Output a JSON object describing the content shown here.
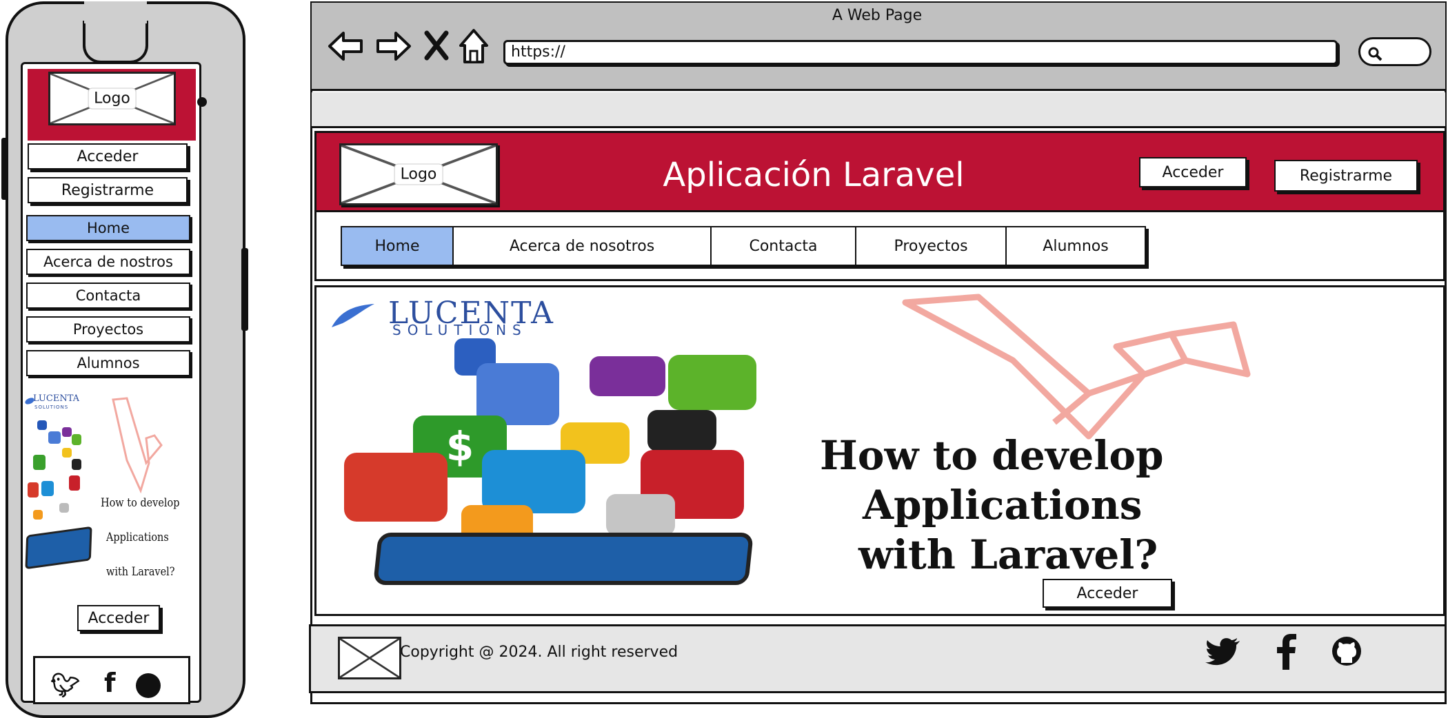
{
  "colors": {
    "brand": "#BC1234",
    "active": "#99BBF0",
    "chrome": "#C0C0C0",
    "strip": "#E6E6E6",
    "laravel": "#F2A8A0"
  },
  "browser": {
    "title": "A Web Page",
    "url": "https://",
    "icons": [
      "back-icon",
      "forward-icon",
      "close-icon",
      "home-icon",
      "search-icon"
    ]
  },
  "header": {
    "logo_label": "Logo",
    "app_title": "Aplicación Laravel",
    "login_label": "Acceder",
    "register_label": "Registrarme"
  },
  "nav": {
    "items": [
      {
        "label": "Home",
        "active": true
      },
      {
        "label": "Acerca de nosotros",
        "active": false
      },
      {
        "label": "Contacta",
        "active": false
      },
      {
        "label": "Proyectos",
        "active": false
      },
      {
        "label": "Alumnos",
        "active": false
      }
    ]
  },
  "hero": {
    "brand_name": "LUCENTA",
    "brand_sub": "SOLUTIONS",
    "headline_1": "How to develop",
    "headline_2": "Applications",
    "headline_3": "with Laravel?",
    "cta_label": "Acceder"
  },
  "footer": {
    "copyright": "Copyright @ 2024. All right reserved",
    "social_icons": [
      "twitter-icon",
      "facebook-icon",
      "github-icon"
    ]
  },
  "mobile": {
    "logo_label": "Logo",
    "login_label": "Acceder",
    "register_label": "Registrarme",
    "menu": [
      {
        "label": "Home",
        "active": true
      },
      {
        "label": "Acerca de nostros",
        "active": false
      },
      {
        "label": "Contacta",
        "active": false
      },
      {
        "label": "Proyectos",
        "active": false
      },
      {
        "label": "Alumnos",
        "active": false
      }
    ],
    "brand_name": "LUCENTA",
    "brand_sub": "SOLUTIONS",
    "headline_1": "How to develop",
    "headline_2": "Applications",
    "headline_3": "with Laravel?",
    "cta_label": "Acceder"
  }
}
